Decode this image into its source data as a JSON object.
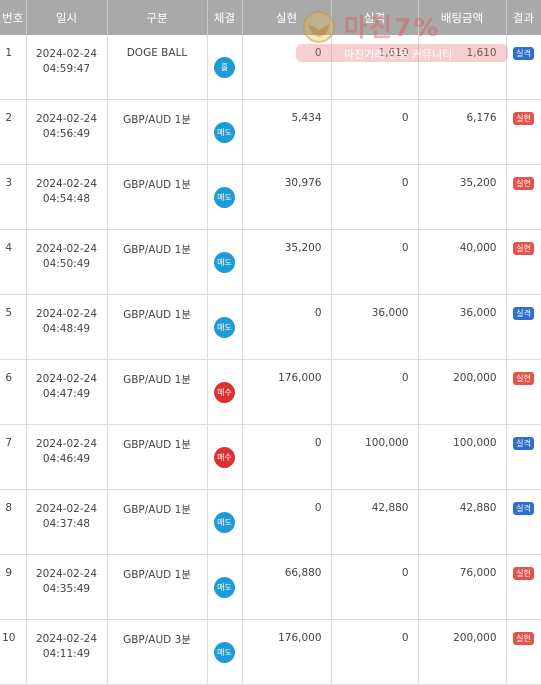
{
  "headers": [
    "번호",
    "일시",
    "구분",
    "체결",
    "실현",
    "실격",
    "배팅금액",
    "결과"
  ],
  "rows": [
    {
      "no": "1",
      "date": "2024-02-24",
      "time": "04:59:47",
      "category": "DOGE BALL",
      "type": "홀",
      "type_color": "blue",
      "realized": "0",
      "lost": "1,610",
      "bet": "1,610",
      "result": "실격",
      "result_color": "blue"
    },
    {
      "no": "2",
      "date": "2024-02-24",
      "time": "04:56:49",
      "category": "GBP/AUD 1분",
      "type": "매도",
      "type_color": "blue",
      "realized": "5,434",
      "lost": "0",
      "bet": "6,176",
      "result": "실현",
      "result_color": "red"
    },
    {
      "no": "3",
      "date": "2024-02-24",
      "time": "04:54:48",
      "category": "GBP/AUD 1분",
      "type": "매도",
      "type_color": "blue",
      "realized": "30,976",
      "lost": "0",
      "bet": "35,200",
      "result": "실현",
      "result_color": "red"
    },
    {
      "no": "4",
      "date": "2024-02-24",
      "time": "04:50:49",
      "category": "GBP/AUD 1분",
      "type": "매도",
      "type_color": "blue",
      "realized": "35,200",
      "lost": "0",
      "bet": "40,000",
      "result": "실현",
      "result_color": "red"
    },
    {
      "no": "5",
      "date": "2024-02-24",
      "time": "04:48:49",
      "category": "GBP/AUD 1분",
      "type": "매도",
      "type_color": "blue",
      "realized": "0",
      "lost": "36,000",
      "bet": "36,000",
      "result": "실격",
      "result_color": "blue"
    },
    {
      "no": "6",
      "date": "2024-02-24",
      "time": "04:47:49",
      "category": "GBP/AUD 1분",
      "type": "매수",
      "type_color": "red",
      "realized": "176,000",
      "lost": "0",
      "bet": "200,000",
      "result": "실현",
      "result_color": "red"
    },
    {
      "no": "7",
      "date": "2024-02-24",
      "time": "04:46:49",
      "category": "GBP/AUD 1분",
      "type": "매수",
      "type_color": "red",
      "realized": "0",
      "lost": "100,000",
      "bet": "100,000",
      "result": "실격",
      "result_color": "blue"
    },
    {
      "no": "8",
      "date": "2024-02-24",
      "time": "04:37:48",
      "category": "GBP/AUD 1분",
      "type": "매도",
      "type_color": "blue",
      "realized": "0",
      "lost": "42,880",
      "bet": "42,880",
      "result": "실격",
      "result_color": "blue"
    },
    {
      "no": "9",
      "date": "2024-02-24",
      "time": "04:35:49",
      "category": "GBP/AUD 1분",
      "type": "매도",
      "type_color": "blue",
      "realized": "66,880",
      "lost": "0",
      "bet": "76,000",
      "result": "실현",
      "result_color": "red"
    },
    {
      "no": "10",
      "date": "2024-02-24",
      "time": "04:11:49",
      "category": "GBP/AUD 3분",
      "type": "매도",
      "type_color": "blue",
      "realized": "176,000",
      "lost": "0",
      "bet": "200,000",
      "result": "실현",
      "result_color": "red"
    }
  ],
  "watermark": {
    "title": "마진7%",
    "subtitle": "마진거래 전문 커뮤니티"
  }
}
